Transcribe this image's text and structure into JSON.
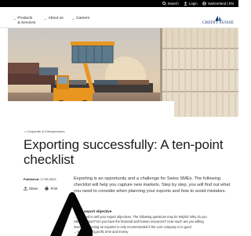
{
  "topbar": {
    "search": "Search",
    "login": "Login",
    "region": "Switzerland | EN"
  },
  "nav": {
    "items": [
      "Products",
      "& Services",
      "About us",
      "Careers"
    ]
  },
  "logo": {
    "wordmark": "CREDIT SUISSE"
  },
  "article": {
    "breadcrumb": "< Corporate & Entrepreneurs",
    "title": "Exporting successfully: A ten-point checklist",
    "published_label": "Published:",
    "published_date": "17.05.2022",
    "share": "Share",
    "print": "Print",
    "lead": "Exporting is an opportunity and a challenge for Swiss SMEs. The following checklist will help you capture new markets. Step by step, you will find out what you need to consider when planning your exports and how to avoid mistakes.",
    "section_heading": "r export objective",
    "body_lines": [
      "...you need to sell your export objectives. The following questions may be helpful: Why do you",
      "SME in export? Do you have the financial and human resources? How much are you willing",
      "invest? Becoming an exporter is only recommended if the core company is in good",
      "... experiencing profit, time and money"
    ]
  }
}
